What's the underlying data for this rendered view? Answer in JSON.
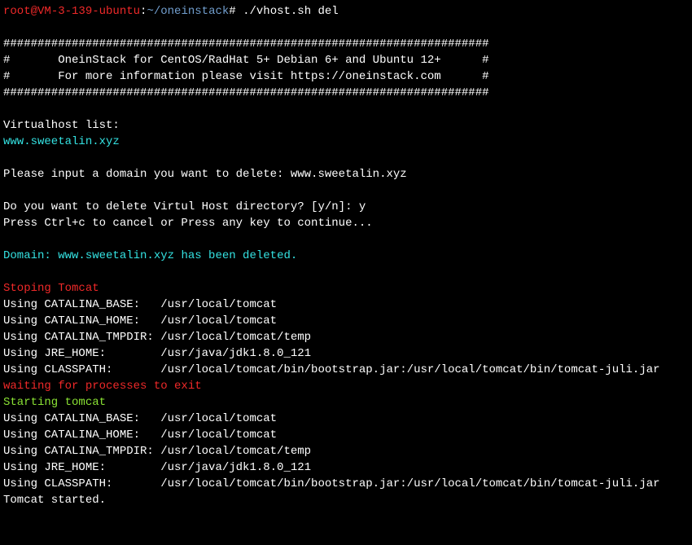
{
  "prompt": {
    "user": "root",
    "at": "@",
    "host": "VM-3-139-ubuntu",
    "colon": ":",
    "path": "~/oneinstack",
    "hash": "# ",
    "command": "./vhost.sh del"
  },
  "banner": {
    "border": "#######################################################################",
    "line1": "#       OneinStack for CentOS/RadHat 5+ Debian 6+ and Ubuntu 12+      #",
    "line2": "#       For more information please visit https://oneinstack.com      #"
  },
  "blank": "",
  "vhost_label": "Virtualhost list:",
  "vhost_domain": "www.sweetalin.xyz",
  "input_line": "Please input a domain you want to delete: www.sweetalin.xyz",
  "delete_confirm": "Do you want to delete Virtul Host directory? [y/n]: y",
  "ctrlc": "Press Ctrl+c to cancel or Press any key to continue...",
  "deleted_prefix": "Domain: ",
  "deleted_domain": "www.sweetalin.xyz",
  "deleted_suffix": " has been deleted.",
  "stop_tomcat": "Stoping Tomcat",
  "env1": "Using CATALINA_BASE:   /usr/local/tomcat",
  "env2": "Using CATALINA_HOME:   /usr/local/tomcat",
  "env3": "Using CATALINA_TMPDIR: /usr/local/tomcat/temp",
  "env4": "Using JRE_HOME:        /usr/java/jdk1.8.0_121",
  "env5": "Using CLASSPATH:       /usr/local/tomcat/bin/bootstrap.jar:/usr/local/tomcat/bin/tomcat-juli.jar",
  "waiting": "waiting for processes to exit",
  "starting": "Starting tomcat",
  "env6": "Using CATALINA_BASE:   /usr/local/tomcat",
  "env7": "Using CATALINA_HOME:   /usr/local/tomcat",
  "env8": "Using CATALINA_TMPDIR: /usr/local/tomcat/temp",
  "env9": "Using JRE_HOME:        /usr/java/jdk1.8.0_121",
  "env10": "Using CLASSPATH:       /usr/local/tomcat/bin/bootstrap.jar:/usr/local/tomcat/bin/tomcat-juli.jar",
  "tomcat_started": "Tomcat started."
}
